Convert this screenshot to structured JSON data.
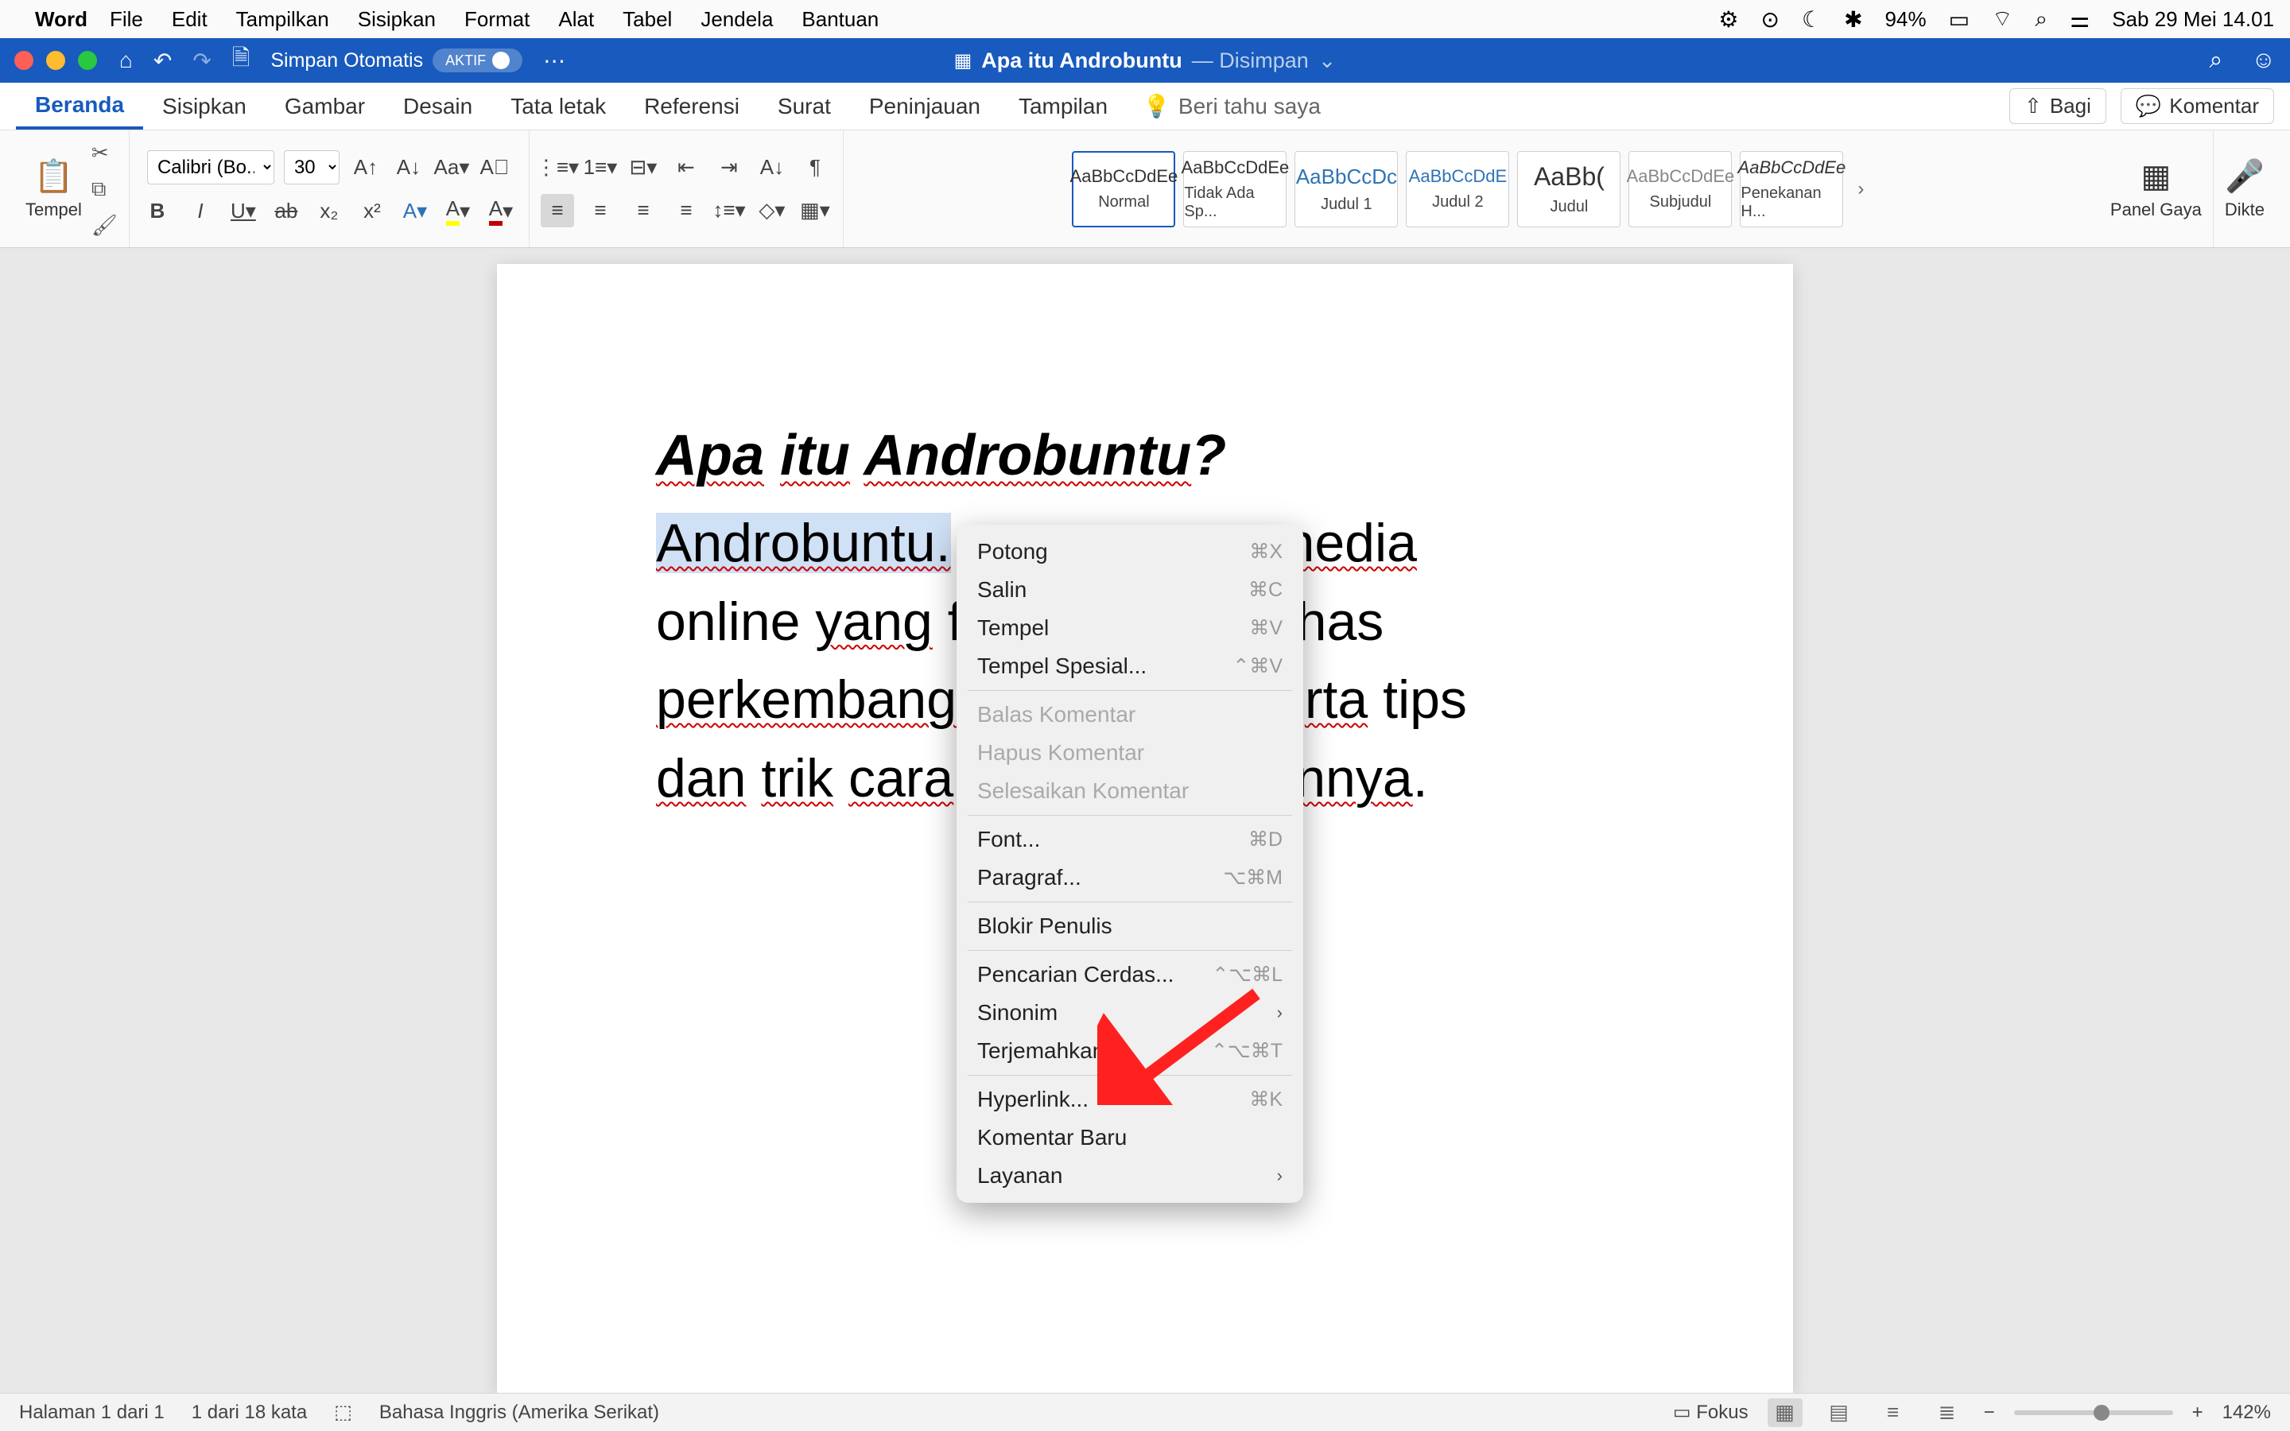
{
  "mac_menu": {
    "app": "Word",
    "items": [
      "File",
      "Edit",
      "Tampilkan",
      "Sisipkan",
      "Format",
      "Alat",
      "Tabel",
      "Jendela",
      "Bantuan"
    ],
    "battery": "94%",
    "datetime": "Sab 29 Mei 14.01"
  },
  "titlebar": {
    "autosave_label": "Simpan Otomatis",
    "autosave_state": "AKTIF",
    "doc_name": "Apa itu Androbuntu",
    "status": "— Disimpan"
  },
  "ribbon_tabs": {
    "tabs": [
      "Beranda",
      "Sisipkan",
      "Gambar",
      "Desain",
      "Tata letak",
      "Referensi",
      "Surat",
      "Peninjauan",
      "Tampilan"
    ],
    "tell_me": "Beri tahu saya",
    "share": "Bagi",
    "comments": "Komentar"
  },
  "ribbon": {
    "paste": "Tempel",
    "font_name": "Calibri (Bo...",
    "font_size": "30",
    "styles": [
      {
        "preview": "AaBbCcDdEe",
        "name": "Normal",
        "cls": ""
      },
      {
        "preview": "AaBbCcDdEe",
        "name": "Tidak Ada Sp...",
        "cls": ""
      },
      {
        "preview": "AaBbCcDc",
        "name": "Judul 1",
        "cls": "blue"
      },
      {
        "preview": "AaBbCcDdE",
        "name": "Judul 2",
        "cls": "blue"
      },
      {
        "preview": "AaBb(",
        "name": "Judul",
        "cls": ""
      },
      {
        "preview": "AaBbCcDdEe",
        "name": "Subjudul",
        "cls": ""
      },
      {
        "preview": "AaBbCcDdEe",
        "name": "Penekanan H...",
        "cls": ""
      }
    ],
    "styles_pane": "Panel Gaya",
    "dictate": "Dikte"
  },
  "document": {
    "title_parts": [
      "Apa",
      " ",
      "itu",
      " ",
      "Androbuntu",
      "?"
    ],
    "body_selected": "Androbuntu.",
    "body_rest_1": "nedia",
    "body_line2_a": "online ",
    "body_line2_b": "yang",
    "body_line2_c": " f",
    "body_line2_d": "has",
    "body_line3_a": "perkembanga",
    "body_line3_b": "rta",
    "body_line3_c": " tips",
    "body_line4_a": "dan",
    "body_line4_b": " ",
    "body_line4_c": "trik",
    "body_line4_d": " ",
    "body_line4_e": "cara",
    "body_line4_f": "nnya",
    "body_line4_g": "."
  },
  "context_menu": {
    "items": [
      {
        "label": "Potong",
        "shortcut": "⌘X",
        "disabled": false
      },
      {
        "label": "Salin",
        "shortcut": "⌘C",
        "disabled": false
      },
      {
        "label": "Tempel",
        "shortcut": "⌘V",
        "disabled": false
      },
      {
        "label": "Tempel Spesial...",
        "shortcut": "⌃⌘V",
        "disabled": false
      },
      {
        "sep": true
      },
      {
        "label": "Balas Komentar",
        "shortcut": "",
        "disabled": true
      },
      {
        "label": "Hapus Komentar",
        "shortcut": "",
        "disabled": true
      },
      {
        "label": "Selesaikan Komentar",
        "shortcut": "",
        "disabled": true
      },
      {
        "sep": true
      },
      {
        "label": "Font...",
        "shortcut": "⌘D",
        "disabled": false
      },
      {
        "label": "Paragraf...",
        "shortcut": "⌥⌘M",
        "disabled": false
      },
      {
        "sep": true
      },
      {
        "label": "Blokir Penulis",
        "shortcut": "",
        "disabled": false
      },
      {
        "sep": true
      },
      {
        "label": "Pencarian Cerdas...",
        "shortcut": "⌃⌥⌘L",
        "disabled": false
      },
      {
        "label": "Sinonim",
        "shortcut": "",
        "disabled": false,
        "submenu": true
      },
      {
        "label": "Terjemahkan...",
        "shortcut": "⌃⌥⌘T",
        "disabled": false
      },
      {
        "sep": true
      },
      {
        "label": "Hyperlink...",
        "shortcut": "⌘K",
        "disabled": false
      },
      {
        "label": "Komentar Baru",
        "shortcut": "",
        "disabled": false
      },
      {
        "label": "Layanan",
        "shortcut": "",
        "disabled": false,
        "submenu": true
      }
    ]
  },
  "statusbar": {
    "page": "Halaman 1 dari 1",
    "words": "1 dari 18 kata",
    "lang": "Bahasa Inggris (Amerika Serikat)",
    "focus": "Fokus",
    "zoom": "142%"
  }
}
